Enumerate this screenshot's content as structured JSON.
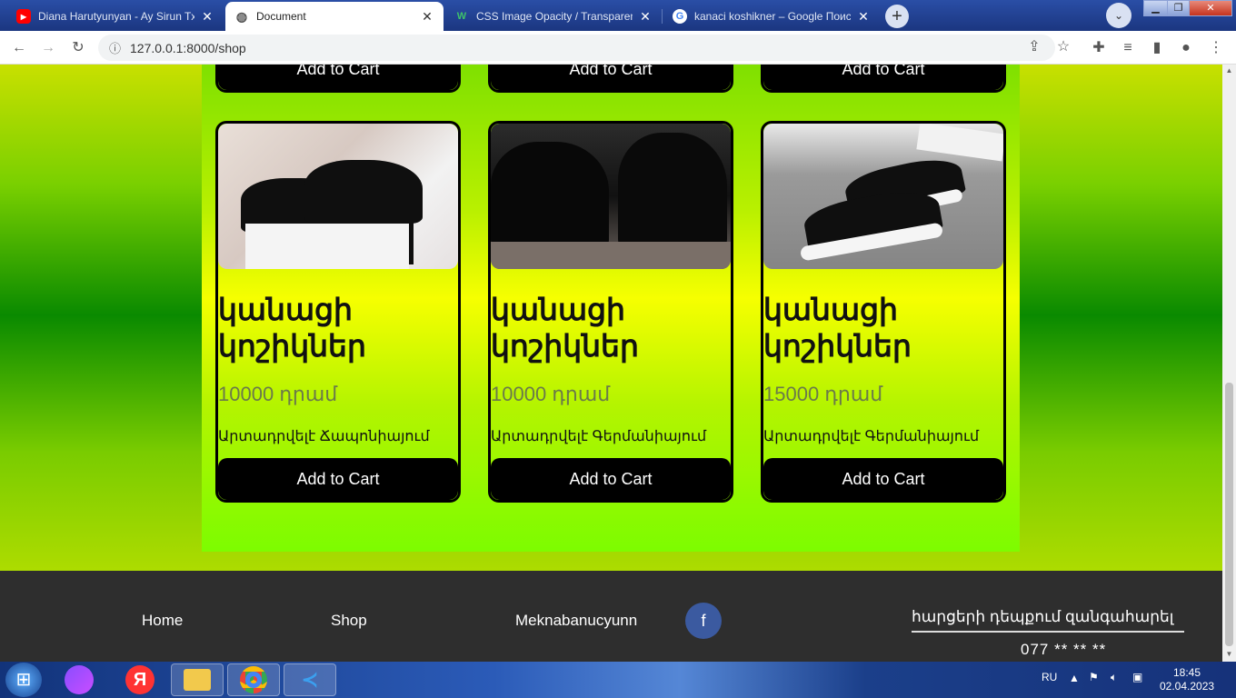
{
  "browser": {
    "tabs": [
      {
        "title": "Diana Harutyunyan - Ay Sirun Txa",
        "icon": "youtube-icon",
        "active": false
      },
      {
        "title": "Document",
        "icon": "globe-icon",
        "active": true
      },
      {
        "title": "CSS Image Opacity / Transparenc",
        "icon": "w3schools-icon",
        "active": false
      },
      {
        "title": "kanaci koshikner – Google Поиск",
        "icon": "google-icon",
        "active": false
      }
    ],
    "url": "127.0.0.1:8000/shop"
  },
  "shop": {
    "top_row_buttons": [
      "Add to Cart",
      "Add to Cart",
      "Add to Cart"
    ],
    "products": [
      {
        "title": "կանացի կոշիկներ",
        "price": "10000 դրամ",
        "origin": "Արտադրվելէ Ճապոնիայում",
        "button": "Add to Cart"
      },
      {
        "title": "կանացի կոշիկներ",
        "price": "10000 դրամ",
        "origin": "Արտադրվելէ Գերմանիայում",
        "button": "Add to Cart"
      },
      {
        "title": "կանացի կոշիկներ",
        "price": "15000 դրամ",
        "origin": "Արտադրվելէ Գերմանիայում",
        "button": "Add to Cart"
      }
    ]
  },
  "footer": {
    "links": [
      "Home",
      "Shop",
      "Meknabanucyunn"
    ],
    "facebook": "f",
    "contact_label": "հարցերի դեպքում զանգահարել",
    "phone": "077 ** ** **"
  },
  "taskbar": {
    "lang": "RU",
    "time": "18:45",
    "date": "02.04.2023"
  }
}
